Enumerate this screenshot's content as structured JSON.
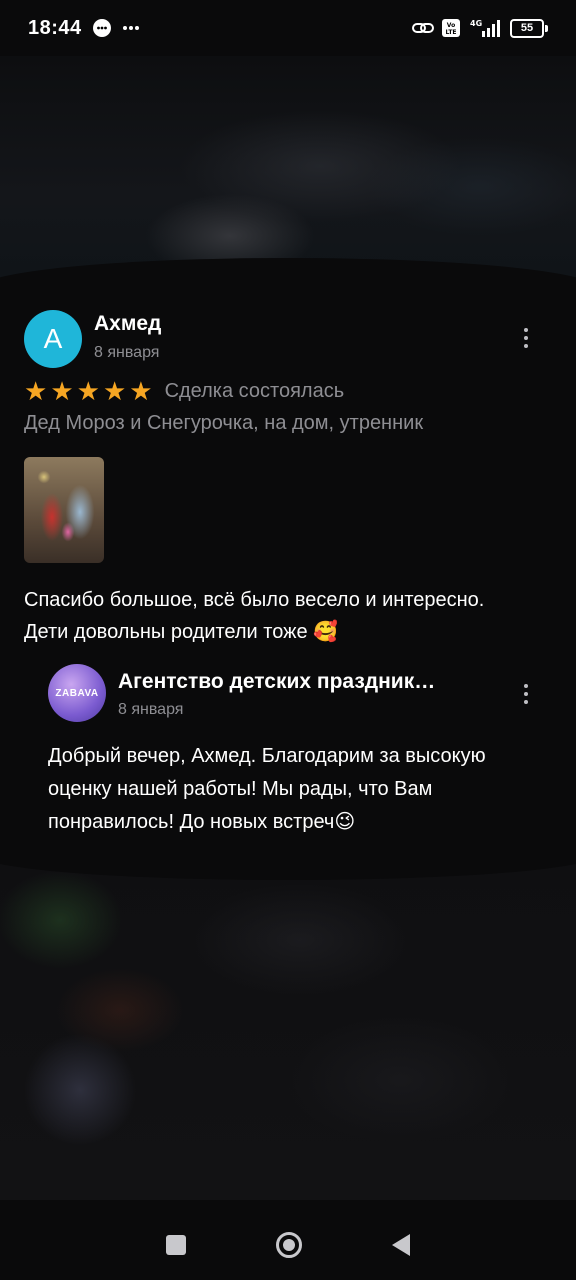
{
  "status_bar": {
    "time": "18:44",
    "battery": "55",
    "network": "4G",
    "icons": [
      "message-bubble-icon",
      "more-dots-icon",
      "link-icon",
      "volte-icon",
      "signal-icon",
      "battery-icon"
    ]
  },
  "review": {
    "avatar_letter": "А",
    "avatar_color": "#1fb6d9",
    "author": "Ахмед",
    "date": "8 января",
    "rating": 5,
    "stars": [
      "★",
      "★",
      "★",
      "★",
      "★"
    ],
    "star_color": "#f6a623",
    "deal_status": "Сделка состоялась",
    "service": "Дед Мороз и Снегурочка, на дом, утренник",
    "text_line1": "Спасибо большое, всё было весело и интересно.",
    "text_line2": "Дети довольны родители тоже",
    "text_emoji": "🥰"
  },
  "reply": {
    "avatar_text": "ZABAVA",
    "name": "Агентство детских праздник…",
    "date": "8 января",
    "text_line1": "Добрый вечер, Ахмед. Благодарим за высокую",
    "text_line2": "оценку нашей работы! Мы рады, что Вам",
    "text_line3": "понравилось! До новых встреч",
    "text_emoji": "😉"
  },
  "nav_bar": {
    "items": [
      "recents-button",
      "home-button",
      "back-button"
    ]
  }
}
